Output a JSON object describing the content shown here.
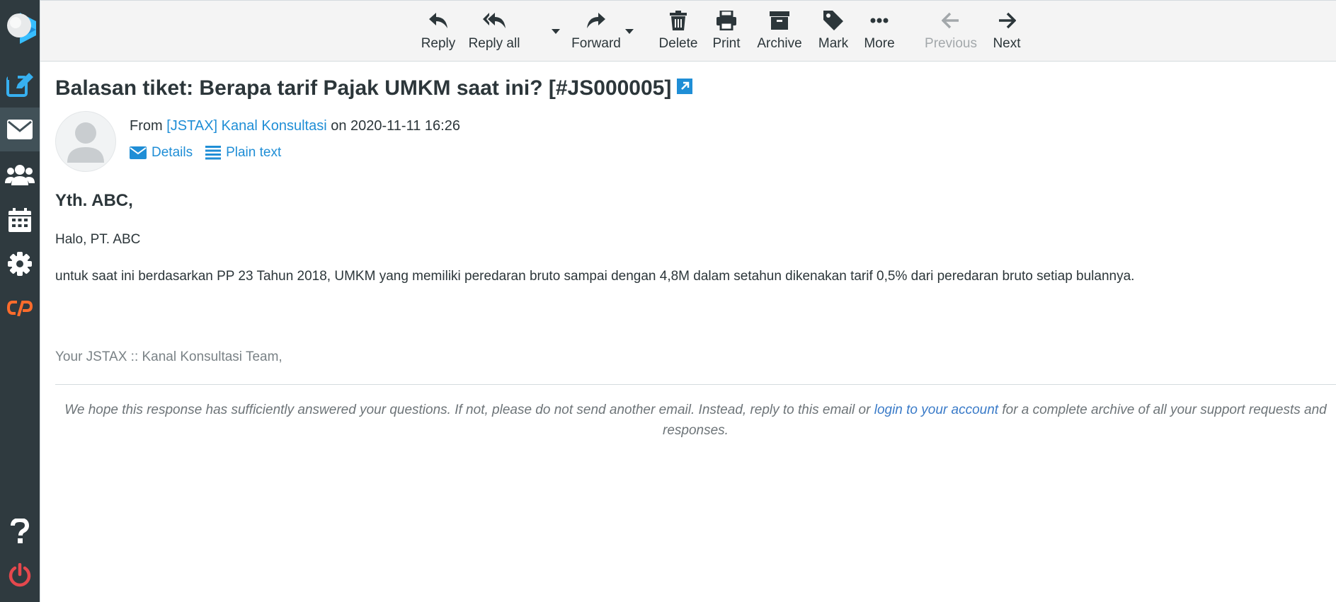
{
  "toolbar": {
    "reply": "Reply",
    "reply_all": "Reply all",
    "forward": "Forward",
    "delete": "Delete",
    "print": "Print",
    "archive": "Archive",
    "mark": "Mark",
    "more": "More",
    "previous": "Previous",
    "next": "Next"
  },
  "message": {
    "subject": "Balasan tiket: Berapa tarif Pajak UMKM saat ini? [#JS000005]",
    "from_prefix": "From",
    "sender": "[JSTAX] Kanal Konsultasi",
    "date_prefix": "on",
    "date": "2020-11-11 16:26",
    "details": "Details",
    "plain_text": "Plain text",
    "greeting": "Yth. ABC,",
    "line1": "Halo, PT. ABC",
    "line2": "untuk saat ini berdasarkan PP 23 Tahun 2018, UMKM yang memiliki peredaran bruto sampai dengan 4,8M dalam setahun dikenakan tarif 0,5% dari peredaran bruto setiap bulannya.",
    "signature": "Your JSTAX :: Kanal Konsultasi Team,",
    "footer_pre": "We hope this response has sufficiently answered your questions. If not, please do not send another email. Instead, reply to this email or",
    "footer_link": "login to your account",
    "footer_post": "for a complete archive of all your support requests and responses."
  },
  "colors": {
    "sidebar_bg": "#2f3a3f",
    "accent": "#1f8ed6",
    "logout": "#e5484d",
    "cpanel": "#ff6c2c"
  }
}
